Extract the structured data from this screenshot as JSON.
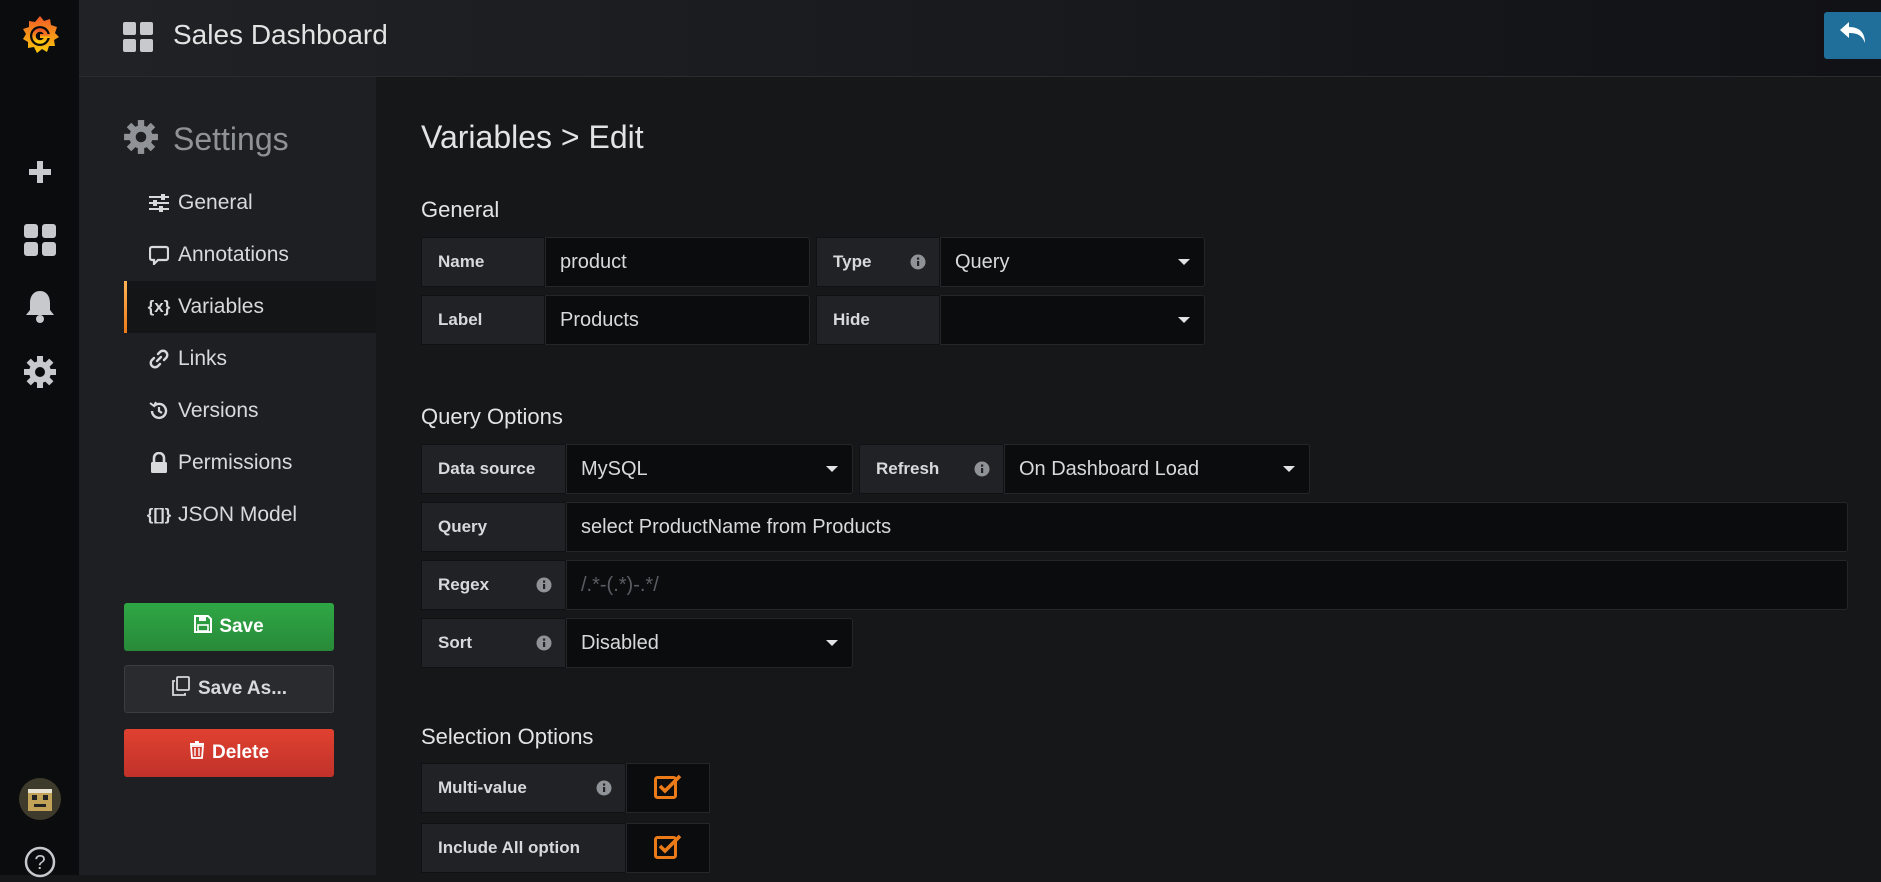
{
  "app": {
    "name": "Grafana"
  },
  "topbar": {
    "dashboard_title": "Sales Dashboard"
  },
  "sidebar_rail": {
    "items": [
      {
        "name": "grafana-logo",
        "icon": "grafana-logo-icon"
      },
      {
        "name": "create",
        "icon": "plus-icon"
      },
      {
        "name": "dashboards",
        "icon": "dashboards-grid-icon"
      },
      {
        "name": "alerting",
        "icon": "bell-icon"
      },
      {
        "name": "configuration",
        "icon": "gear-icon"
      },
      {
        "name": "profile",
        "icon": "avatar-icon"
      },
      {
        "name": "help",
        "icon": "help-icon",
        "glyph": "?"
      }
    ]
  },
  "settings": {
    "title": "Settings",
    "items": [
      {
        "label": "General",
        "icon": "sliders-icon"
      },
      {
        "label": "Annotations",
        "icon": "comment-icon"
      },
      {
        "label": "Variables",
        "icon": "variable-icon",
        "glyph": "{x}",
        "active": true
      },
      {
        "label": "Links",
        "icon": "link-icon"
      },
      {
        "label": "Versions",
        "icon": "history-icon"
      },
      {
        "label": "Permissions",
        "icon": "lock-icon"
      },
      {
        "label": "JSON Model",
        "icon": "json-icon",
        "glyph": "{[]}"
      }
    ],
    "save_label": "Save",
    "save_as_label": "Save As...",
    "delete_label": "Delete"
  },
  "editor": {
    "heading": "Variables > Edit",
    "general": {
      "title": "General",
      "name_label": "Name",
      "name_value": "product",
      "type_label": "Type",
      "type_value": "Query",
      "label_label": "Label",
      "label_value": "Products",
      "hide_label": "Hide",
      "hide_value": ""
    },
    "query_options": {
      "title": "Query Options",
      "datasource_label": "Data source",
      "datasource_value": "MySQL",
      "refresh_label": "Refresh",
      "refresh_value": "On Dashboard Load",
      "query_label": "Query",
      "query_value": "select ProductName from Products",
      "regex_label": "Regex",
      "regex_placeholder": "/.*-(.*)-.*/",
      "sort_label": "Sort",
      "sort_value": "Disabled"
    },
    "selection_options": {
      "title": "Selection Options",
      "multi_value_label": "Multi-value",
      "multi_value_checked": true,
      "include_all_label": "Include All option",
      "include_all_checked": true
    }
  },
  "colors": {
    "accent_orange": "#eb7b18",
    "save_green": "#2fa745",
    "delete_red": "#e04130",
    "back_blue": "#1f6f9a"
  }
}
